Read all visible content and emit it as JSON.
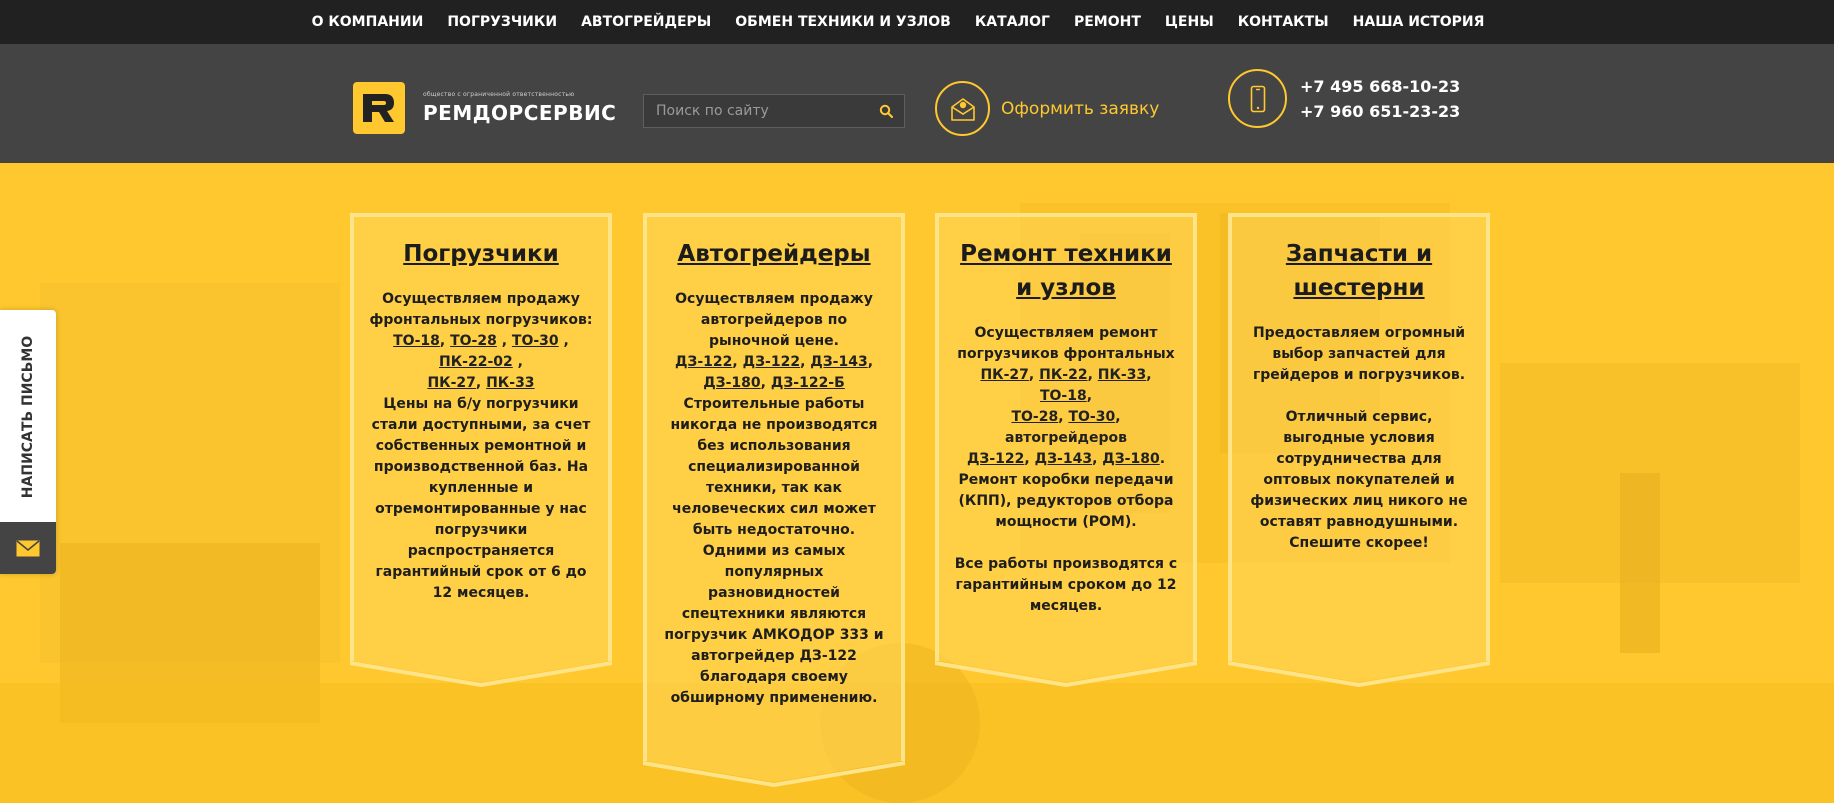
{
  "nav": {
    "items": [
      "О КОМПАНИИ",
      "ПОГРУЗЧИКИ",
      "АВТОГРЕЙДЕРЫ",
      "ОБМЕН ТЕХНИКИ И УЗЛОВ",
      "КАТАЛОГ",
      "РЕМОНТ",
      "ЦЕНЫ",
      "КОНТАКТЫ",
      "НАША ИСТОРИЯ"
    ]
  },
  "header": {
    "logo_sub": "общество с ограниченной ответственностью",
    "logo_name": "РЕМДОРСЕРВИС",
    "search_placeholder": "Поиск по сайту",
    "order_label": "Оформить заявку",
    "phones": [
      "+7 495 668-10-23",
      "+7 960 651-23-23"
    ]
  },
  "cards": [
    {
      "title": "Погрузчики",
      "intro": "Осуществляем продажу фронтальных погрузчиков:",
      "body": "Цены на б/у погрузчики стали доступными, за счет собственных ремонтной и производственной баз. На купленные и отремонтированные у нас погрузчики распространяется гарантийный срок от 6 до 12 месяцев."
    },
    {
      "title": "Автогрейдеры",
      "intro": "Осуществляем продажу автогрейдеров по рыночной цене.",
      "body": "Строительные работы никогда не производятся без использования специализированной техники, так как человеческих сил может быть недостаточно. Одними из самых популярных разновидностей спецтехники являются погрузчик АМКОДОР 333 и автогрейдер ДЗ-122 благодаря своему обширному применению."
    },
    {
      "title": "Ремонт техники и узлов",
      "intro": "Осуществляем ремонт погрузчиков фронтальных",
      "mid": "автогрейдеров",
      "body": "Ремонт коробки передачи (КПП), редукторов отбора мощности (РОМ).",
      "body2": "Все работы производятся с гарантийным сроком до 12 месяцев."
    },
    {
      "title": "Запчасти и шестерни",
      "intro": "Предоставляем огромный выбор запчастей для грейдеров и погрузчиков.",
      "body": "Отличный сервис, выгодные условия сотрудничества для оптовых покупателей и физических лиц никого не оставят равнодушными. Спешите скорее!"
    }
  ],
  "links": {
    "c1": [
      "ТО-18",
      "ТО-28",
      "ТО-30",
      "ПК-22-02",
      "ПК-27",
      "ПК-33"
    ],
    "c2": [
      "ДЗ-122",
      "ДЗ-122",
      "ДЗ-143",
      "ДЗ-180",
      "ДЗ-122-Б"
    ],
    "c3a": [
      "ПК-27",
      "ПК-22",
      "ПК-33",
      "ТО-18",
      "ТО-28",
      "ТО-30"
    ],
    "c3b": [
      "ДЗ-122",
      "ДЗ-143",
      "ДЗ-180"
    ]
  },
  "sidetab": {
    "label": "НАПИСАТЬ ПИСЬМО"
  },
  "colors": {
    "accent": "#ffc82e",
    "dark": "#212121",
    "header": "#444444"
  },
  "icons": {
    "search": "search-icon",
    "order": "envelope-icon",
    "phone": "smartphone-icon",
    "mail": "mail-icon",
    "logo": "logo-r-icon"
  }
}
